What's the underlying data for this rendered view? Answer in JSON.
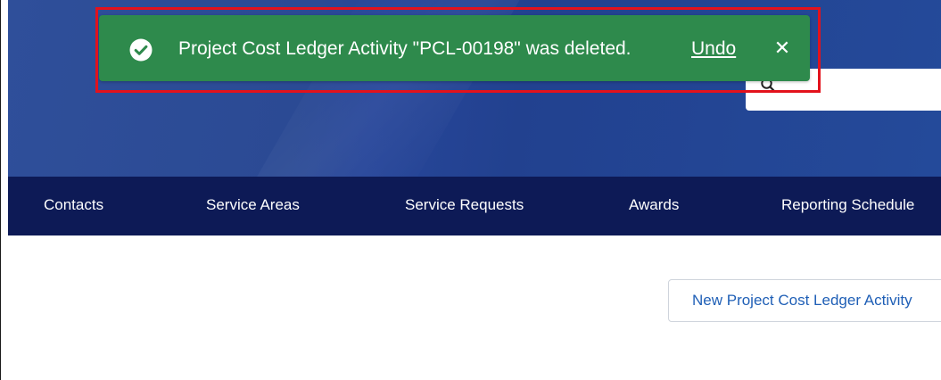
{
  "toast": {
    "message": "Project Cost Ledger Activity \"PCL-00198\" was deleted.",
    "undo_label": "Undo",
    "close_label": "✕",
    "color": "#2e8a4c"
  },
  "nav": {
    "items": [
      {
        "label": "Contacts"
      },
      {
        "label": "Service Areas"
      },
      {
        "label": "Service Requests"
      },
      {
        "label": "Awards"
      },
      {
        "label": "Reporting Schedule"
      }
    ],
    "color": "#0d1a56"
  },
  "main": {
    "new_button_label": "New Project Cost Ledger Activity"
  },
  "colors": {
    "banner": "#2b4a94",
    "highlight": "#e3121c",
    "link": "#1f5fb6"
  },
  "icons": {
    "toast": "check-circle-icon",
    "search": "search-icon",
    "close": "close-icon"
  }
}
